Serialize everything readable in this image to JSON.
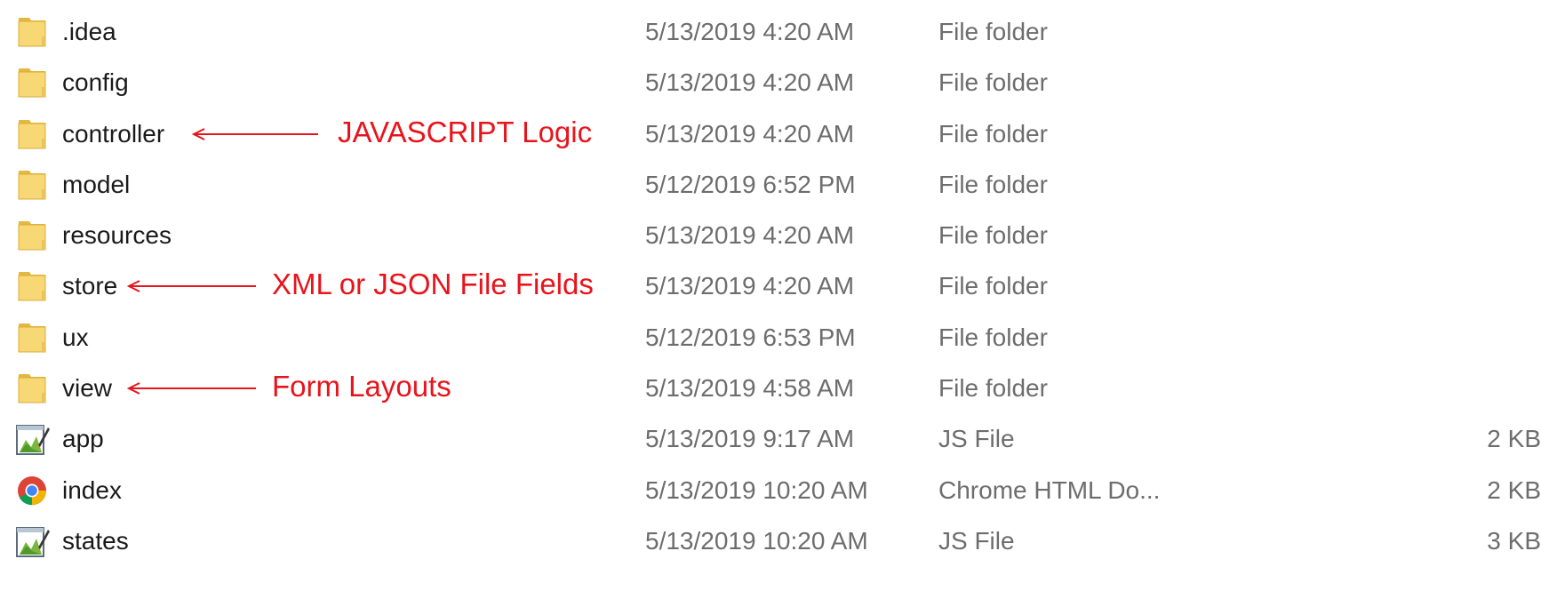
{
  "files": [
    {
      "name": ".idea",
      "date": "5/13/2019 4:20 AM",
      "type": "File folder",
      "size": "",
      "icon": "folder-icon"
    },
    {
      "name": "config",
      "date": "5/13/2019 4:20 AM",
      "type": "File folder",
      "size": "",
      "icon": "folder-icon"
    },
    {
      "name": "controller",
      "date": "5/13/2019 4:20 AM",
      "type": "File folder",
      "size": "",
      "icon": "folder-icon"
    },
    {
      "name": "model",
      "date": "5/12/2019 6:52 PM",
      "type": "File folder",
      "size": "",
      "icon": "folder-icon"
    },
    {
      "name": "resources",
      "date": "5/13/2019 4:20 AM",
      "type": "File folder",
      "size": "",
      "icon": "folder-icon"
    },
    {
      "name": "store",
      "date": "5/13/2019 4:20 AM",
      "type": "File folder",
      "size": "",
      "icon": "folder-icon"
    },
    {
      "name": "ux",
      "date": "5/12/2019 6:53 PM",
      "type": "File folder",
      "size": "",
      "icon": "folder-icon"
    },
    {
      "name": "view",
      "date": "5/13/2019 4:58 AM",
      "type": "File folder",
      "size": "",
      "icon": "folder-icon"
    },
    {
      "name": "app",
      "date": "5/13/2019 9:17 AM",
      "type": "JS File",
      "size": "2 KB",
      "icon": "js-file-icon"
    },
    {
      "name": "index",
      "date": "5/13/2019 10:20 AM",
      "type": "Chrome HTML Do...",
      "size": "2 KB",
      "icon": "chrome-icon"
    },
    {
      "name": "states",
      "date": "5/13/2019 10:20 AM",
      "type": "JS File",
      "size": "3 KB",
      "icon": "js-file-icon"
    }
  ],
  "annotations": [
    {
      "row": 2,
      "text": "JAVASCRIPT Logic",
      "color": "#e8141c"
    },
    {
      "row": 5,
      "text": "XML or JSON File Fields",
      "color": "#e8141c"
    },
    {
      "row": 7,
      "text": "Form Layouts",
      "color": "#e8141c"
    }
  ],
  "colors": {
    "folder": "#f8d775",
    "folder_dark": "#e3b740",
    "annotation": "#e8141c",
    "secondary_text": "#6d6d6d"
  }
}
